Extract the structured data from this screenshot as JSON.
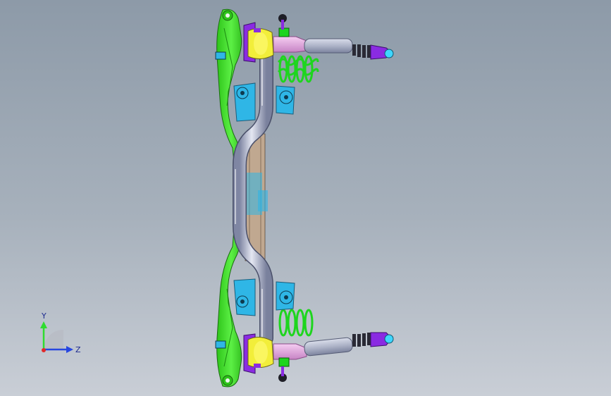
{
  "viewport": {
    "title": "",
    "triad": {
      "y_label": "Y",
      "z_label": "Z"
    }
  },
  "colors": {
    "background_top": "#8d9aa8",
    "background_bottom": "#c9ced6",
    "frame_green": "#39e21f",
    "bushing_yellow": "#f2ee3a",
    "mount_purple": "#8a2be2",
    "bracket_cyan": "#2fb6e6",
    "tube_silver": "#b9bfd2",
    "tube_pink": "#e7a9e3",
    "spring_green": "#1ed51e",
    "axis_y": "#2fdc2f",
    "axis_z": "#2747e0",
    "axis_x": "#e02a2a"
  },
  "icons": [
    "suspension-assembly-model",
    "coordinate-triad-icon"
  ]
}
